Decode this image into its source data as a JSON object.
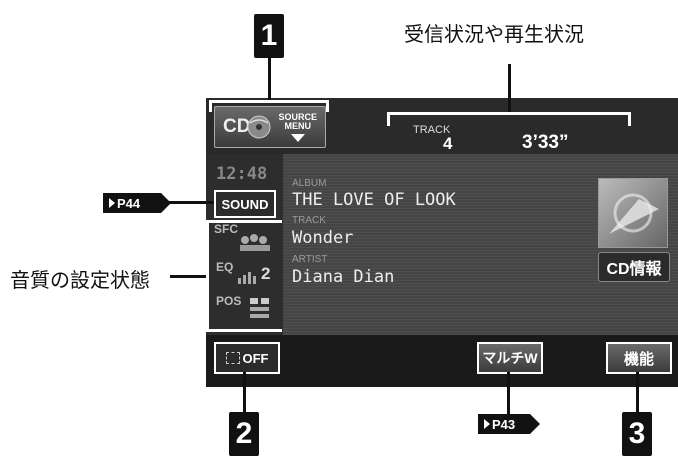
{
  "callouts": {
    "reception_status": "受信状況や再生状況",
    "sound_settings": "音質の設定状態"
  },
  "badges": {
    "one": "1",
    "two": "2",
    "three": "3"
  },
  "page_refs": {
    "sound": "P44",
    "multi": "P43"
  },
  "source": {
    "cd_label": "CD",
    "source_label": "SOURCE",
    "menu_label": "MENU"
  },
  "track_info": {
    "track_label": "TRACK",
    "track_number": "4",
    "time": "3’33”"
  },
  "left_panel": {
    "clock": "12:48",
    "sound_button": "SOUND",
    "sfc_label": "SFC",
    "eq_label": "EQ",
    "eq_value": "2",
    "pos_label": "POS"
  },
  "info": {
    "album_label": "ALBUM",
    "album": "THE LOVE OF LOOK",
    "track_label": "TRACK",
    "track": "Wonder",
    "artist_label": "ARTIST",
    "artist": "Diana Dian"
  },
  "cd_info_button": "CD情報",
  "bottom": {
    "off_label": "OFF",
    "multi_label": "マルチW",
    "function_label": "機能"
  }
}
